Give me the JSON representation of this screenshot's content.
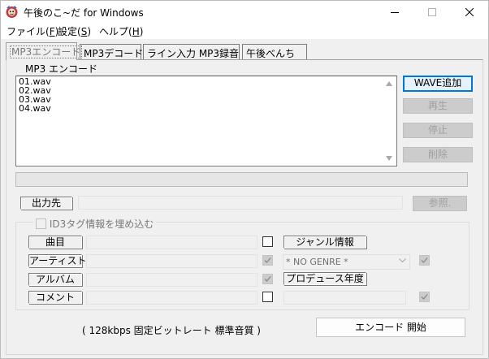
{
  "window": {
    "title": "午後のこ~だ for Windows",
    "app_icon": "app-logo-icon",
    "controls": [
      "minimize-icon",
      "maximize-icon",
      "close-icon"
    ]
  },
  "menu": {
    "items": [
      {
        "label": "ファイル(",
        "key": "F",
        "tail": ")"
      },
      {
        "label": "設定(",
        "key": "S",
        "tail": ")"
      },
      {
        "label": "ヘルプ(",
        "key": "H",
        "tail": ")"
      }
    ]
  },
  "tabs": [
    {
      "label": "MP3エンコード",
      "active": true
    },
    {
      "label": "MP3デコード",
      "active": false
    },
    {
      "label": "ライン入力 MP3録音",
      "active": false
    },
    {
      "label": "午後べんち",
      "active": false
    }
  ],
  "encode": {
    "group_label": "MP3 エンコード",
    "files": [
      "01.wav",
      "02.wav",
      "03.wav",
      "04.wav"
    ],
    "buttons": {
      "add_wave": "WAVE追加",
      "play": "再生",
      "stop": "停止",
      "delete": "削除",
      "browse": "参照.",
      "encode_start": "エンコード 開始"
    },
    "output_label": "出力先",
    "output_value": "",
    "id3": {
      "embed_label": "ID3タグ情報を埋め込む",
      "embed_checked": false,
      "title_label": "曲目",
      "artist_label": "アーティスト",
      "album_label": "アルバム",
      "comment_label": "コメント",
      "genre_label": "ジャンル情報",
      "genre_value": "* NO GENRE *",
      "year_label": "プロデュース年度"
    },
    "status_text": "( 128kbps  固定ビットレート 標準音質 )"
  }
}
